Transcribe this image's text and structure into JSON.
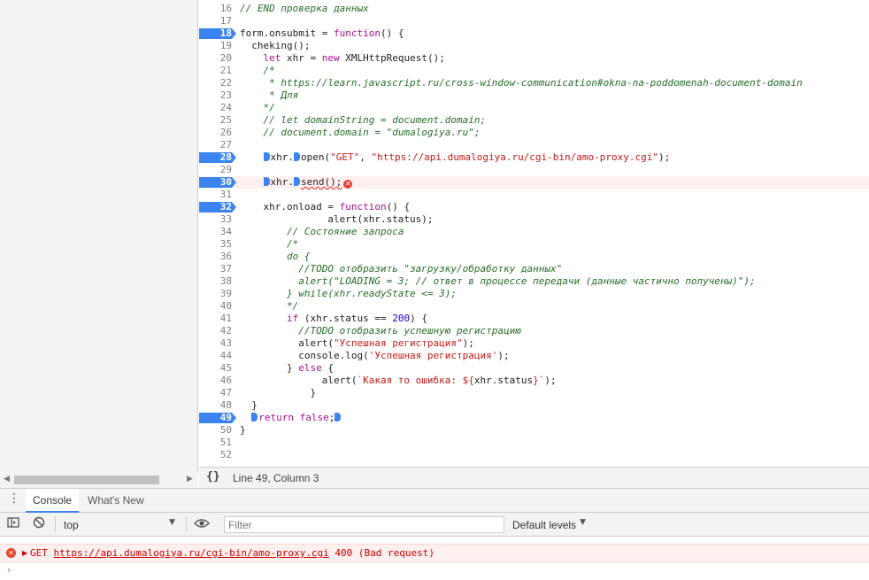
{
  "editor": {
    "lines": [
      {
        "no": "16",
        "bp": false,
        "html": "<span class=\"cm\">// END проверка данных</span>"
      },
      {
        "no": "17",
        "bp": false,
        "html": ""
      },
      {
        "no": "18",
        "bp": true,
        "html": "form.onsubmit = <span class=\"kw\">function</span>() {"
      },
      {
        "no": "19",
        "bp": false,
        "html": "  cheking();"
      },
      {
        "no": "20",
        "bp": false,
        "html": "    <span class=\"kw\">let</span> xhr = <span class=\"kw\">new</span> XMLHttpRequest();"
      },
      {
        "no": "21",
        "bp": false,
        "html": "    <span class=\"cm\">/*</span>"
      },
      {
        "no": "22",
        "bp": false,
        "html": "<span class=\"cm\">     * https://learn.javascript.ru/cross-window-communication#okna-na-poddomenah-document-domain</span>"
      },
      {
        "no": "23",
        "bp": false,
        "html": "<span class=\"cm\">     * Для</span>"
      },
      {
        "no": "24",
        "bp": false,
        "html": "<span class=\"cm\">    */</span>"
      },
      {
        "no": "25",
        "bp": false,
        "html": "    <span class=\"cm\">// let domainString = document.domain;</span>"
      },
      {
        "no": "26",
        "bp": false,
        "html": "    <span class=\"cm\">// document.domain = \"dumalogiya.ru\";</span>"
      },
      {
        "no": "27",
        "bp": false,
        "html": ""
      },
      {
        "no": "28",
        "bp": true,
        "html": "    <span class=\"mk\"></span>xhr.<span class=\"mk\"></span>open(<span class=\"st\">\"GET\"</span>, <span class=\"st\">\"https://api.dumalogiya.ru/cgi-bin/amo-proxy.cgi\"</span>);"
      },
      {
        "no": "29",
        "bp": false,
        "html": ""
      },
      {
        "no": "30",
        "bp": true,
        "err": true,
        "html": "    <span class=\"mk\"></span>xhr.<span class=\"mk\"></span><span class=\"squig\">send();</span><span class=\"err-icon\" data-name=\"error-icon\" data-interactable=\"true\">✕</span>"
      },
      {
        "no": "31",
        "bp": false,
        "html": ""
      },
      {
        "no": "32",
        "bp": true,
        "html": "    xhr.onload = <span class=\"kw\">function</span>() {"
      },
      {
        "no": "33",
        "bp": false,
        "html": "               alert(xhr.status);"
      },
      {
        "no": "34",
        "bp": false,
        "html": "        <span class=\"cm\">// Состояние запроса</span>"
      },
      {
        "no": "35",
        "bp": false,
        "html": "        <span class=\"cm\">/*</span>"
      },
      {
        "no": "36",
        "bp": false,
        "html": "<span class=\"cm\">        do {</span>"
      },
      {
        "no": "37",
        "bp": false,
        "html": "<span class=\"cm\">          //TODO отобразить \"загрузку/обработку данных\"</span>"
      },
      {
        "no": "38",
        "bp": false,
        "html": "<span class=\"cm\">          alert(\"LOADING = 3; // ответ в процессе передачи (данные частично получены)\");</span>"
      },
      {
        "no": "39",
        "bp": false,
        "html": "<span class=\"cm\">        } while(xhr.readyState &lt;= 3);</span>"
      },
      {
        "no": "40",
        "bp": false,
        "html": "<span class=\"cm\">        */</span>"
      },
      {
        "no": "41",
        "bp": false,
        "html": "        <span class=\"kw\">if</span> (xhr.status == <span class=\"nm\">200</span>) {"
      },
      {
        "no": "42",
        "bp": false,
        "html": "          <span class=\"cm\">//TODO отобразить успешную регистрацию</span>"
      },
      {
        "no": "43",
        "bp": false,
        "html": "          alert(<span class=\"st\">\"Успешная регистрация\"</span>);"
      },
      {
        "no": "44",
        "bp": false,
        "html": "          console.log(<span class=\"st\">'Успешная регистрация'</span>);"
      },
      {
        "no": "45",
        "bp": false,
        "html": "        } <span class=\"kw\">else</span> {"
      },
      {
        "no": "46",
        "bp": false,
        "html": "              alert(<span class=\"st\">`Какая то ошибка: ${</span>xhr.status<span class=\"st\">}`</span>);"
      },
      {
        "no": "47",
        "bp": false,
        "html": "            }"
      },
      {
        "no": "48",
        "bp": false,
        "html": "  }"
      },
      {
        "no": "49",
        "bp": true,
        "html": "  <span class=\"mk\"></span><span class=\"kw\">return</span> <span class=\"kw\">false</span>;<span class=\"mk\"></span>"
      },
      {
        "no": "50",
        "bp": false,
        "html": "}"
      },
      {
        "no": "51",
        "bp": false,
        "html": ""
      },
      {
        "no": "52",
        "bp": false,
        "html": ""
      }
    ]
  },
  "statusbar": {
    "format_icon": "{}",
    "cursor_position": "Line 49, Column 3"
  },
  "drawer": {
    "menu_icon": "⋮",
    "tabs": [
      "Console",
      "What's New"
    ]
  },
  "console_toolbar": {
    "context": "top",
    "filter_placeholder": "Filter",
    "levels": "Default levels"
  },
  "console": {
    "error": {
      "method": "GET",
      "url": "https://api.dumalogiya.ru/cgi-bin/amo-proxy.cgi",
      "status": "400 (Bad request)"
    },
    "prompt": "›"
  },
  "colors": {
    "breakpoint": "#3b84f0",
    "error": "#e34234",
    "error_bg": "#fff0f0"
  }
}
